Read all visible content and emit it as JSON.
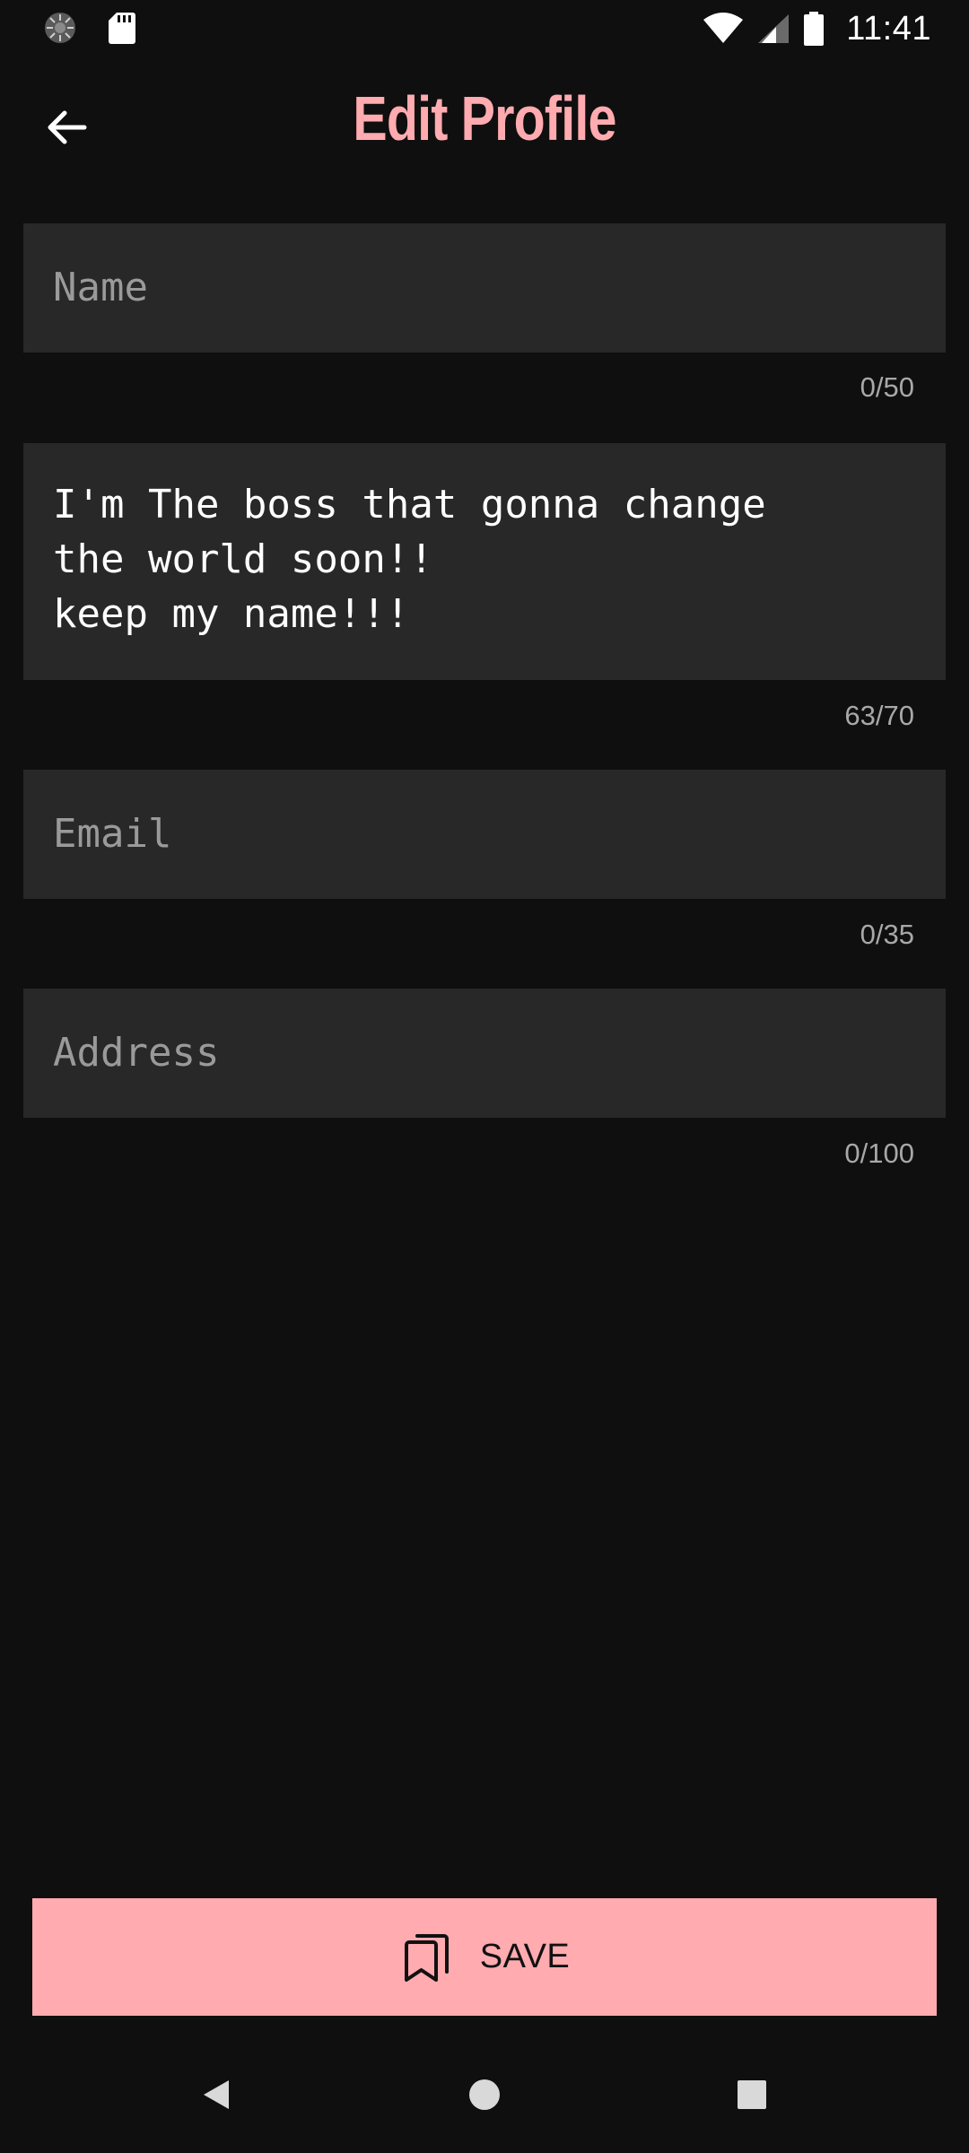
{
  "status_bar": {
    "time": "11:41",
    "icons": [
      "sync-status-icon",
      "sd-card-icon",
      "wifi-icon",
      "cell-signal-icon",
      "battery-icon"
    ]
  },
  "app_bar": {
    "title": "Edit Profile",
    "back_icon": "arrow-left-icon"
  },
  "form": {
    "name": {
      "placeholder": "Name",
      "value": "",
      "counter": "0/50"
    },
    "bio": {
      "value": "I'm The boss that gonna change\nthe world soon!!\nkeep my name!!!",
      "counter": "63/70"
    },
    "email": {
      "placeholder": "Email",
      "value": "",
      "counter": "0/35"
    },
    "address": {
      "placeholder": "Address",
      "value": "",
      "counter": "0/100"
    }
  },
  "save_button": {
    "label": "SAVE",
    "icon": "bookmarks-icon"
  },
  "nav_bar": {
    "icons": [
      "nav-back-icon",
      "nav-home-icon",
      "nav-recents-icon"
    ]
  },
  "colors": {
    "background": "#0f0f0f",
    "field_background": "#282828",
    "accent": "#ffabb0"
  }
}
